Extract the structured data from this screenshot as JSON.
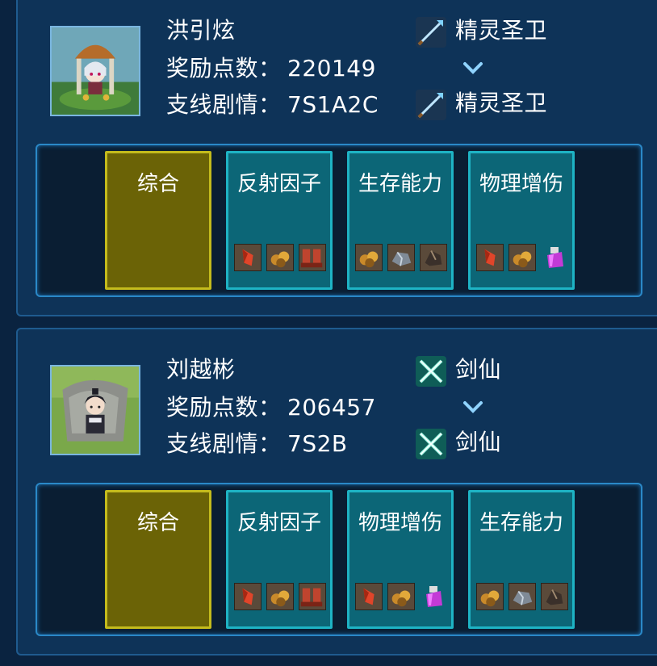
{
  "players": [
    {
      "name": "洪引炫",
      "reward_label": "奖励点数：",
      "reward_value": "220149",
      "branch_label": "支线剧情：",
      "branch_value": "7S1A2C",
      "class_from": "精灵圣卫",
      "class_to": "精灵圣卫",
      "class_icon": "spear-icon",
      "tabs": [
        {
          "label": "综合",
          "style": "gold",
          "items": []
        },
        {
          "label": "反射因子",
          "style": "teal",
          "items": [
            "red-crystal-icon",
            "ore-icon",
            "boots-icon"
          ]
        },
        {
          "label": "生存能力",
          "style": "teal",
          "items": [
            "ore-icon",
            "iron-ore-icon",
            "dark-ore-icon"
          ]
        },
        {
          "label": "物理增伤",
          "style": "teal",
          "items": [
            "red-crystal-icon",
            "ore-icon",
            "potion-icon"
          ]
        }
      ]
    },
    {
      "name": "刘越彬",
      "reward_label": "奖励点数：",
      "reward_value": "206457",
      "branch_label": "支线剧情：",
      "branch_value": "7S2B",
      "class_from": "剑仙",
      "class_to": "剑仙",
      "class_icon": "crossed-swords-icon",
      "tabs": [
        {
          "label": "综合",
          "style": "gold",
          "items": []
        },
        {
          "label": "反射因子",
          "style": "teal",
          "items": [
            "red-crystal-icon",
            "ore-icon",
            "boots-icon"
          ]
        },
        {
          "label": "物理增伤",
          "style": "teal",
          "items": [
            "red-crystal-icon",
            "ore-icon",
            "potion-icon"
          ]
        },
        {
          "label": "生存能力",
          "style": "teal",
          "items": [
            "ore-icon",
            "iron-ore-icon",
            "dark-ore-icon"
          ]
        }
      ]
    }
  ],
  "colors": {
    "background": "#0a2340",
    "card": "#0e3358",
    "tab_teal": "#0c6677",
    "tab_gold": "#6b6306",
    "accent": "#2a89c8"
  }
}
